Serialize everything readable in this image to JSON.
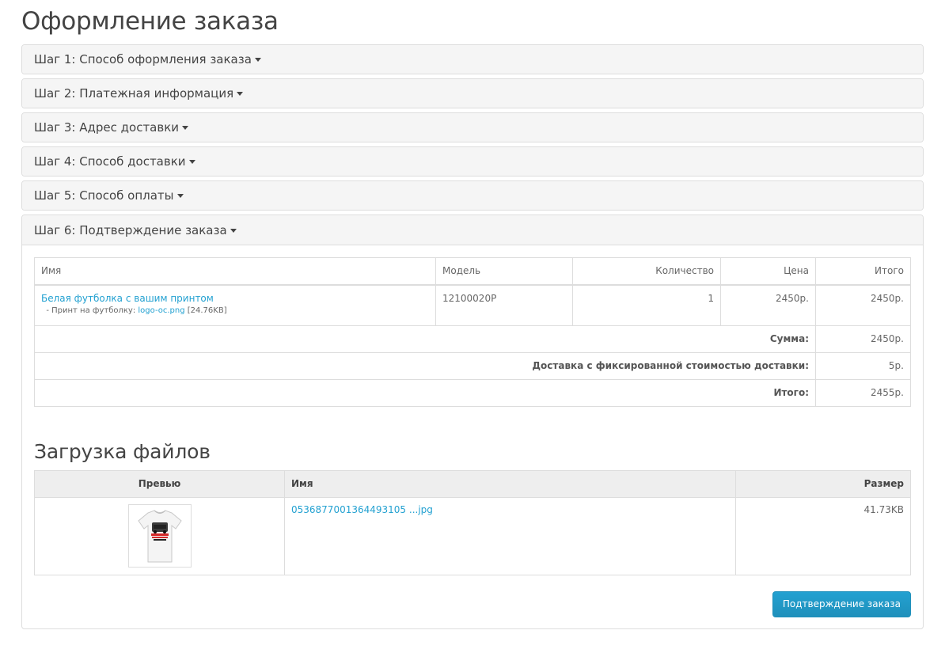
{
  "page": {
    "title": "Оформление заказа"
  },
  "steps": [
    {
      "label": "Шаг 1: Способ оформления заказа"
    },
    {
      "label": "Шаг 2: Платежная информация"
    },
    {
      "label": "Шаг 3: Адрес доставки"
    },
    {
      "label": "Шаг 4: Способ доставки"
    },
    {
      "label": "Шаг 5: Способ оплаты"
    },
    {
      "label": "Шаг 6: Подтверждение заказа"
    }
  ],
  "cart": {
    "headers": {
      "name": "Имя",
      "model": "Модель",
      "quantity": "Количество",
      "price": "Цена",
      "total": "Итого"
    },
    "product": {
      "name": "Белая футболка с вашим принтом",
      "option_label": "- Принт на футболку:",
      "option_file": "logo-oc.png",
      "option_size": "[24.76KB]",
      "model": "12100020P",
      "quantity": "1",
      "price": "2450р.",
      "total": "2450р."
    },
    "totals": [
      {
        "label": "Сумма:",
        "value": "2450р."
      },
      {
        "label": "Доставка с фиксированной стоимостью доставки:",
        "value": "5р."
      },
      {
        "label": "Итого:",
        "value": "2455р."
      }
    ]
  },
  "uploads": {
    "title": "Загрузка файлов",
    "headers": {
      "preview": "Превью",
      "name": "Имя",
      "size": "Размер"
    },
    "file": {
      "name": "0536877001364493105 ...jpg",
      "size": "41.73KB",
      "preview_icon": "tshirt-image"
    }
  },
  "actions": {
    "confirm_label": "Подтверждение заказа"
  },
  "colors": {
    "accent": "#229ac8",
    "link": "#23a1d1",
    "heading_bg": "#f5f5f5",
    "border": "#dddddd"
  }
}
